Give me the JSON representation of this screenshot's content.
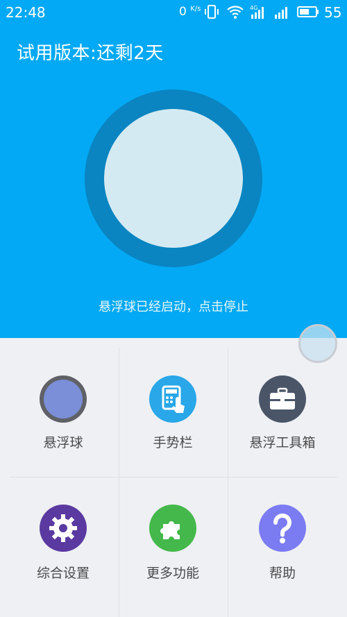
{
  "status_bar": {
    "time": "22:48",
    "net_speed_value": "0",
    "net_speed_unit": "K/s",
    "signal_type": "4G",
    "battery": "55",
    "icons": [
      "vibrate-icon",
      "wifi-icon",
      "signal-4g-icon",
      "signal-icon",
      "battery-icon"
    ]
  },
  "header": {
    "trial_text": "试用版本:还剩2天"
  },
  "main": {
    "status_text": "悬浮球已经启动，点击停止"
  },
  "colors": {
    "primary": "#03a9f4",
    "ring": "#0a85c1",
    "ring_inner": "#d4eaf3",
    "background": "#eef0f4"
  },
  "menu": {
    "items": [
      {
        "label": "悬浮球",
        "icon": "floating-ball-icon",
        "color": "#7a8fd8"
      },
      {
        "label": "手势栏",
        "icon": "gesture-bar-icon",
        "color": "#29a7e8"
      },
      {
        "label": "悬浮工具箱",
        "icon": "toolbox-icon",
        "color": "#4a5568"
      },
      {
        "label": "综合设置",
        "icon": "settings-icon",
        "color": "#5a3aa0"
      },
      {
        "label": "更多功能",
        "icon": "puzzle-icon",
        "color": "#44b84a"
      },
      {
        "label": "帮助",
        "icon": "help-icon",
        "color": "#7b7cf2"
      }
    ]
  }
}
